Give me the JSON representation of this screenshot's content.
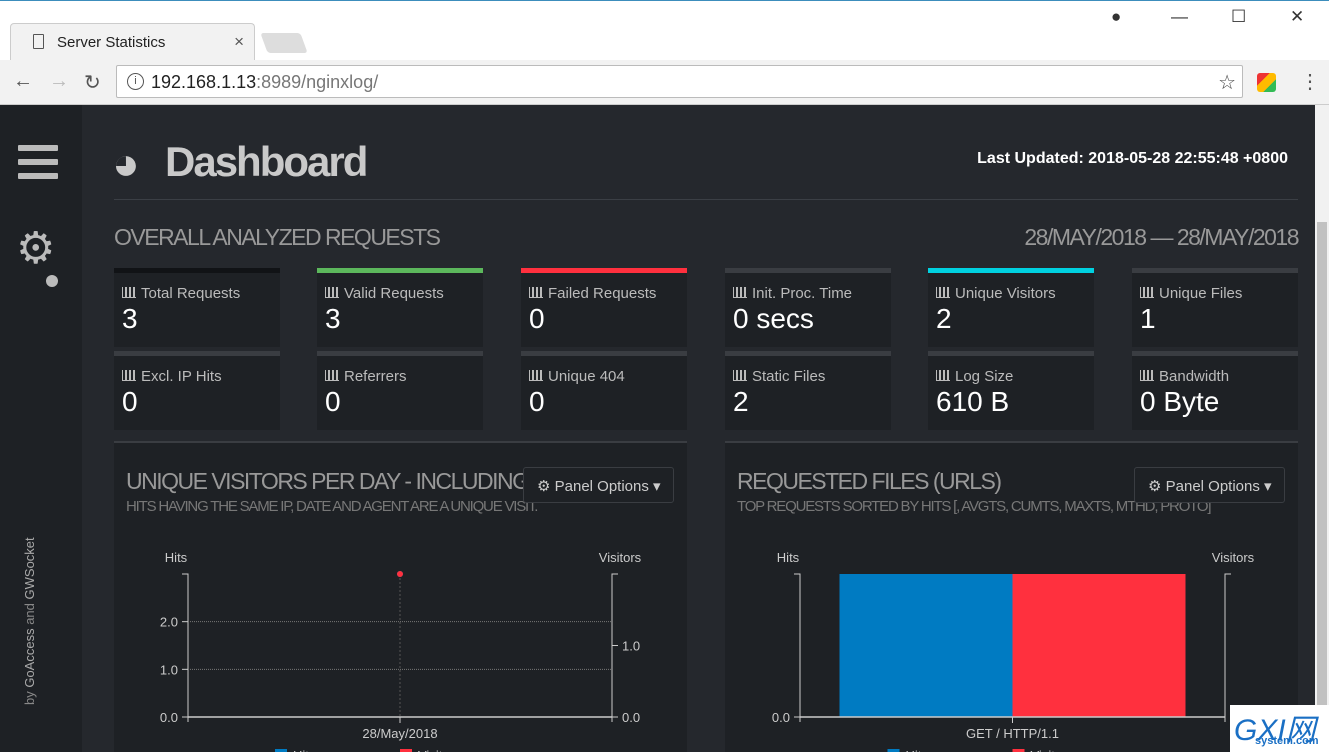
{
  "browser": {
    "tab_title": "Server Statistics",
    "url_host": "192.168.1.13",
    "url_rest": ":8989/nginxlog/"
  },
  "sidebar": {
    "credit_prefix": "by ",
    "goaccess": "GoAccess",
    "and": " and ",
    "gwsocket": "GWSocket"
  },
  "header": {
    "title": "Dashboard",
    "last_updated": "Last Updated: 2018-05-28 22:55:48 +0800"
  },
  "overall": {
    "title": "OVERALL ANALYZED REQUESTS",
    "date_range": "28/MAY/2018 — 28/MAY/2018",
    "cards": [
      {
        "label": "Total Requests",
        "value": "3",
        "accent": "#111316"
      },
      {
        "label": "Valid Requests",
        "value": "3",
        "accent": "#5cb85c"
      },
      {
        "label": "Failed Requests",
        "value": "0",
        "accent": "#ff303e"
      },
      {
        "label": "Init. Proc. Time",
        "value": "0 secs",
        "accent": "#3a3d42"
      },
      {
        "label": "Unique Visitors",
        "value": "2",
        "accent": "#00d1e0"
      },
      {
        "label": "Unique Files",
        "value": "1",
        "accent": "#3a3d42"
      },
      {
        "label": "Excl. IP Hits",
        "value": "0",
        "accent": "#3a3d42"
      },
      {
        "label": "Referrers",
        "value": "0",
        "accent": "#3a3d42"
      },
      {
        "label": "Unique 404",
        "value": "0",
        "accent": "#3a3d42"
      },
      {
        "label": "Static Files",
        "value": "2",
        "accent": "#3a3d42"
      },
      {
        "label": "Log Size",
        "value": "610 B",
        "accent": "#3a3d42"
      },
      {
        "label": "Bandwidth",
        "value": "0 Byte",
        "accent": "#3a3d42"
      }
    ]
  },
  "panels": [
    {
      "title": "UNIQUE VISITORS PER DAY - INCLUDING SPIDERS",
      "subtitle": "HITS HAVING THE SAME IP, DATE AND AGENT ARE A UNIQUE VISIT.",
      "options_label": "Panel Options"
    },
    {
      "title": "REQUESTED FILES (URLS)",
      "subtitle": "TOP REQUESTS SORTED BY HITS [, AVGTS, CUMTS, MAXTS, MTHD, PROTO]",
      "options_label": "Panel Options"
    }
  ],
  "chart_data": [
    {
      "type": "line",
      "ylabel_left": "Hits",
      "ylabel_right": "Visitors",
      "categories": [
        "28/May/2018"
      ],
      "y_left_ticks": [
        "0.0",
        "1.0",
        "2.0"
      ],
      "y_right_ticks": [
        "0.0",
        "1.0"
      ],
      "ylim_left": [
        0,
        3
      ],
      "ylim_right": [
        0,
        2
      ],
      "series": [
        {
          "name": "Hits",
          "values": [
            3
          ],
          "color": "#007bc2"
        },
        {
          "name": "Visitors",
          "values": [
            2
          ],
          "color": "#ff303e"
        }
      ],
      "grid": true,
      "legend": "bottom"
    },
    {
      "type": "bar",
      "ylabel_left": "Hits",
      "ylabel_right": "Visitors",
      "categories": [
        "GET / HTTP/1.1"
      ],
      "y_left_ticks": [
        "0.0"
      ],
      "ylim_left": [
        0,
        3
      ],
      "ylim_right": [
        0,
        2
      ],
      "series": [
        {
          "name": "Hits",
          "values": [
            3
          ],
          "color": "#007bc2"
        },
        {
          "name": "Visitors",
          "values": [
            2
          ],
          "color": "#ff303e"
        }
      ],
      "legend": "bottom"
    }
  ],
  "watermark": {
    "text": "GXI网",
    "sub": "system.com"
  }
}
